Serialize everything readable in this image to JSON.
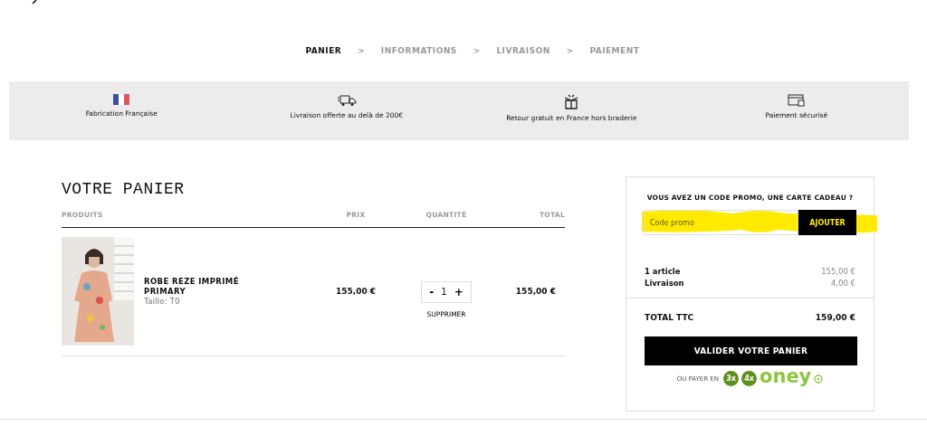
{
  "steps": [
    {
      "label": "PANIER",
      "selected": true
    },
    {
      "label": "INFORMATIONS",
      "selected": false
    },
    {
      "label": "LIVRAISON",
      "selected": false
    },
    {
      "label": "PAIEMENT",
      "selected": false
    }
  ],
  "step_separator": ">",
  "features": [
    {
      "kind": "flag",
      "text": "Fabrication Française"
    },
    {
      "kind": "truck",
      "text": "Livraison offerte au delà de 200€"
    },
    {
      "kind": "box",
      "text": "Retour gratuit en France hors braderie"
    },
    {
      "kind": "card",
      "text": "Paiement sécurisé"
    }
  ],
  "cart": {
    "title": "VOTRE PANIER",
    "columns": [
      "PRODUITS",
      "PRIX",
      "QUANTITÉ",
      "TOTAL"
    ],
    "items": [
      {
        "name": "ROBE REZE IMPRIMÉ PRIMARY",
        "size": "Taille: T0",
        "price": "155,00 €",
        "quantity": "1",
        "minus": "-",
        "plus": "+",
        "remove": "SUPPRIMER",
        "total": "155,00 €"
      }
    ]
  },
  "summary": {
    "promo_title": "VOUS AVEZ UN CODE PROMO, UNE CARTE CADEAU ?",
    "promo_placeholder": "Code promo",
    "promo_button": "AJOUTER",
    "highlighted": true,
    "lines": [
      {
        "label": "1 article",
        "value": "155,00 €"
      },
      {
        "label": "Livraison",
        "value": "4,00 €"
      }
    ],
    "total_label": "TOTAL TTC",
    "total_value": "159,00 €",
    "checkout": "VALIDER VOTRE PANIER",
    "pay_with": "OU PAYER EN",
    "badges": [
      "3x",
      "4x"
    ],
    "brand": "oney"
  }
}
